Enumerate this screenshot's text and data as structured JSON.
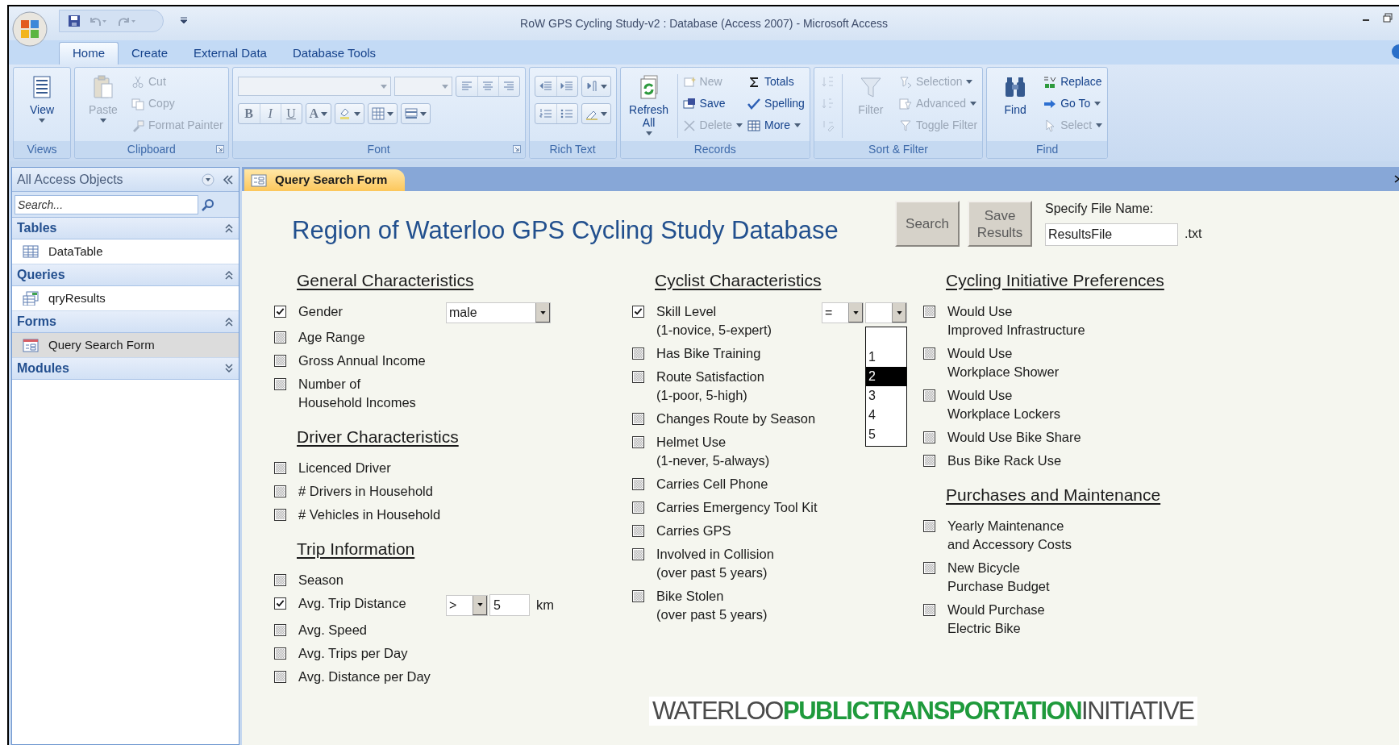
{
  "window": {
    "title": "RoW GPS Cycling Study-v2 : Database (Access 2007) - Microsoft Access"
  },
  "ribbon_tabs": [
    {
      "label": "Home",
      "selected": true
    },
    {
      "label": "Create",
      "selected": false
    },
    {
      "label": "External Data",
      "selected": false
    },
    {
      "label": "Database Tools",
      "selected": false
    }
  ],
  "ribbon_groups": [
    {
      "label": "Views",
      "launcher": false,
      "columns": [
        {
          "kind": "stack",
          "items": [
            {
              "kind": "large",
              "label": "View",
              "dropdown": true,
              "disabled": false
            }
          ]
        }
      ]
    },
    {
      "label": "Clipboard",
      "launcher": true,
      "columns": [
        {
          "kind": "stack",
          "items": [
            {
              "kind": "large",
              "label": "Paste",
              "dropdown": true,
              "disabled": true
            }
          ]
        },
        {
          "kind": "stack",
          "items": [
            {
              "kind": "small",
              "label": "Cut",
              "dropdown": false,
              "disabled": true
            },
            {
              "kind": "small",
              "label": "Copy",
              "dropdown": false,
              "disabled": true
            },
            {
              "kind": "small",
              "label": "Format Painter",
              "dropdown": false,
              "disabled": true
            }
          ]
        }
      ]
    },
    {
      "label": "Font",
      "launcher": true,
      "columns": [
        {
          "kind": "stack",
          "items": [
            {
              "kind": "toolrow",
              "parts": [
                {
                  "kind": "combo",
                  "wide": true
                },
                {
                  "kind": "combo",
                  "wide": false
                },
                {
                  "kind": "cluster",
                  "buttons": [
                    {
                      "kind": "icon",
                      "dropdown": false
                    },
                    {
                      "kind": "icon",
                      "dropdown": false
                    },
                    {
                      "kind": "icon",
                      "dropdown": false
                    }
                  ]
                }
              ]
            },
            {
              "kind": "toolrow",
              "parts": [
                {
                  "kind": "cluster",
                  "buttons": [
                    {
                      "kind": "bold",
                      "label": "B"
                    },
                    {
                      "kind": "italic",
                      "label": "I"
                    },
                    {
                      "kind": "underline",
                      "label": "U"
                    }
                  ]
                },
                {
                  "kind": "cluster",
                  "buttons": [
                    {
                      "kind": "font_color",
                      "label": "A"
                    }
                  ]
                },
                {
                  "kind": "cluster",
                  "buttons": [
                    {
                      "kind": "icon",
                      "dropdown": true
                    }
                  ]
                },
                {
                  "kind": "cluster",
                  "buttons": [
                    {
                      "kind": "icon",
                      "dropdown": true
                    }
                  ]
                },
                {
                  "kind": "cluster",
                  "buttons": [
                    {
                      "kind": "icon",
                      "dropdown": true
                    }
                  ]
                }
              ]
            }
          ]
        }
      ]
    },
    {
      "label": "Rich Text",
      "launcher": false,
      "columns": [
        {
          "kind": "stack",
          "items": [
            {
              "kind": "toolrow",
              "parts": [
                {
                  "kind": "cluster",
                  "buttons": [
                    {
                      "kind": "icon",
                      "dropdown": false
                    },
                    {
                      "kind": "icon",
                      "dropdown": false
                    }
                  ]
                },
                {
                  "kind": "cluster",
                  "buttons": [
                    {
                      "kind": "icon",
                      "dropdown": true
                    }
                  ]
                }
              ]
            },
            {
              "kind": "toolrow",
              "parts": [
                {
                  "kind": "cluster",
                  "buttons": [
                    {
                      "kind": "icon",
                      "dropdown": false
                    },
                    {
                      "kind": "icon",
                      "dropdown": false
                    }
                  ]
                },
                {
                  "kind": "cluster",
                  "buttons": [
                    {
                      "kind": "icon",
                      "dropdown": true
                    }
                  ]
                }
              ]
            }
          ]
        }
      ]
    },
    {
      "label": "Records",
      "launcher": false,
      "columns": [
        {
          "kind": "stack",
          "items": [
            {
              "kind": "large",
              "label": "Refresh All",
              "dropdown": true,
              "disabled": false
            }
          ]
        },
        {
          "kind": "separator"
        },
        {
          "kind": "stack",
          "items": [
            {
              "kind": "small",
              "label": "New",
              "dropdown": false,
              "disabled": true
            },
            {
              "kind": "small",
              "label": "Save",
              "dropdown": false,
              "disabled": false
            },
            {
              "kind": "small",
              "label": "Delete",
              "dropdown": true,
              "disabled": true
            }
          ]
        },
        {
          "kind": "stack",
          "items": [
            {
              "kind": "small",
              "label": "Totals",
              "dropdown": false,
              "disabled": false
            },
            {
              "kind": "small",
              "label": "Spelling",
              "dropdown": false,
              "disabled": false
            },
            {
              "kind": "small",
              "label": "More",
              "dropdown": true,
              "disabled": false
            }
          ]
        }
      ]
    },
    {
      "label": "Sort & Filter",
      "launcher": false,
      "columns": [
        {
          "kind": "stack",
          "items": [
            {
              "kind": "icon",
              "disabled": true
            },
            {
              "kind": "icon",
              "disabled": true
            },
            {
              "kind": "icon",
              "disabled": true
            }
          ]
        },
        {
          "kind": "separator"
        },
        {
          "kind": "stack",
          "items": [
            {
              "kind": "large",
              "label": "Filter",
              "dropdown": false,
              "disabled": true
            }
          ]
        },
        {
          "kind": "stack",
          "items": [
            {
              "kind": "small",
              "label": "Selection",
              "dropdown": true,
              "disabled": true
            },
            {
              "kind": "small",
              "label": "Advanced",
              "dropdown": true,
              "disabled": true
            },
            {
              "kind": "small",
              "label": "Toggle Filter",
              "dropdown": false,
              "disabled": true
            }
          ]
        }
      ]
    },
    {
      "label": "Find",
      "launcher": false,
      "columns": [
        {
          "kind": "stack",
          "items": [
            {
              "kind": "large",
              "label": "Find",
              "dropdown": false,
              "disabled": false
            }
          ]
        },
        {
          "kind": "stack",
          "items": [
            {
              "kind": "small",
              "label": "Replace",
              "dropdown": false,
              "disabled": false
            },
            {
              "kind": "small",
              "label": "Go To",
              "dropdown": true,
              "disabled": false
            },
            {
              "kind": "small",
              "label": "Select",
              "dropdown": true,
              "disabled": true
            }
          ]
        }
      ]
    }
  ],
  "nav_pane": {
    "title": "All Access Objects",
    "search": {
      "placeholder": "Search..."
    },
    "groups": [
      {
        "label": "Tables",
        "expanded": true,
        "items": [
          {
            "label": "DataTable",
            "selected": false
          }
        ]
      },
      {
        "label": "Queries",
        "expanded": true,
        "items": [
          {
            "label": "qryResults",
            "selected": false
          }
        ]
      },
      {
        "label": "Forms",
        "expanded": true,
        "items": [
          {
            "label": "Query Search Form",
            "selected": true
          }
        ]
      },
      {
        "label": "Modules",
        "expanded": false
      }
    ]
  },
  "document_tabs": [
    {
      "label": "Query Search Form",
      "selected": true
    }
  ],
  "form": {
    "title": "Region of Waterloo GPS Cycling Study Database",
    "buttons": [
      {
        "label": "Search"
      },
      {
        "label": "Save\nResults"
      }
    ],
    "file": {
      "label": "Specify File Name:",
      "value": "ResultsFile",
      "suffix": ".txt"
    },
    "columns": [
      {
        "sections": [
          {
            "heading": "General Characteristics",
            "items": [
              {
                "label": "Gender",
                "checked": true,
                "controls": [
                  {
                    "kind": "combo",
                    "value": "male",
                    "expanded": false
                  }
                ]
              },
              {
                "label": "Age Range",
                "checked": false
              },
              {
                "label": "Gross Annual Income",
                "checked": false
              },
              {
                "label": "Number of\nHousehold Incomes",
                "checked": false
              }
            ]
          },
          {
            "heading": "Driver Characteristics",
            "items": [
              {
                "label": "Licenced Driver",
                "checked": false
              },
              {
                "label": "# Drivers in Household",
                "checked": false
              },
              {
                "label": "# Vehicles in Household",
                "checked": false
              }
            ]
          },
          {
            "heading": "Trip Information",
            "items": [
              {
                "label": "Season",
                "checked": false
              },
              {
                "label": "Avg. Trip Distance",
                "checked": true,
                "controls": [
                  {
                    "kind": "combo",
                    "value": ">",
                    "expanded": false
                  },
                  {
                    "kind": "text",
                    "value": "5"
                  },
                  {
                    "kind": "unit",
                    "value": "km"
                  }
                ]
              },
              {
                "label": "Avg. Speed",
                "checked": false
              },
              {
                "label": "Avg. Trips per Day",
                "checked": false
              },
              {
                "label": "Avg. Distance per Day",
                "checked": false
              }
            ]
          }
        ]
      },
      {
        "sections": [
          {
            "heading": "Cyclist Characteristics",
            "items": [
              {
                "label": "Skill Level\n(1-novice, 5-expert)",
                "checked": true,
                "controls": [
                  {
                    "kind": "combo",
                    "value": "=",
                    "expanded": false
                  },
                  {
                    "kind": "combo",
                    "expanded": true,
                    "options": [
                      {
                        "label": "1",
                        "selected": false
                      },
                      {
                        "label": "2",
                        "selected": true
                      },
                      {
                        "label": "3",
                        "selected": false
                      },
                      {
                        "label": "4",
                        "selected": false
                      },
                      {
                        "label": "5",
                        "selected": false
                      }
                    ]
                  }
                ]
              },
              {
                "label": "Has Bike Training",
                "checked": false
              },
              {
                "label": "Route Satisfaction\n(1-poor, 5-high)",
                "checked": false
              },
              {
                "label": "Changes Route by Season",
                "checked": false
              },
              {
                "label": "Helmet Use\n(1-never, 5-always)",
                "checked": false
              },
              {
                "label": "Carries Cell Phone",
                "checked": false
              },
              {
                "label": "Carries Emergency Tool Kit",
                "checked": false
              },
              {
                "label": "Carries GPS",
                "checked": false
              },
              {
                "label": "Involved in Collision\n(over past 5 years)",
                "checked": false
              },
              {
                "label": "Bike Stolen\n(over past 5 years)",
                "checked": false
              }
            ]
          }
        ]
      },
      {
        "sections": [
          {
            "heading": "Cycling Initiative Preferences",
            "items": [
              {
                "label": "Would Use\nImproved Infrastructure",
                "checked": false
              },
              {
                "label": "Would Use\nWorkplace Shower",
                "checked": false
              },
              {
                "label": "Would Use\nWorkplace Lockers",
                "checked": false
              },
              {
                "label": "Would Use Bike Share",
                "checked": false
              },
              {
                "label": "Bus Bike Rack Use",
                "checked": false
              }
            ]
          },
          {
            "heading": "Purchases and Maintenance",
            "items": [
              {
                "label": "Yearly Maintenance\nand Accessory Costs",
                "checked": false
              },
              {
                "label": "New Bicycle\nPurchase Budget",
                "checked": false
              },
              {
                "label": "Would Purchase\nElectric Bike",
                "checked": false
              }
            ]
          }
        ]
      }
    ],
    "logo": {
      "parts": [
        {
          "text": "WATERLOO",
          "color": "#4a4a4a"
        },
        {
          "text": "PUBLICTRANSPORTATION",
          "color": "#1f9a3c"
        },
        {
          "text": "INITIATIVE",
          "color": "#4a4a4a"
        }
      ]
    }
  }
}
